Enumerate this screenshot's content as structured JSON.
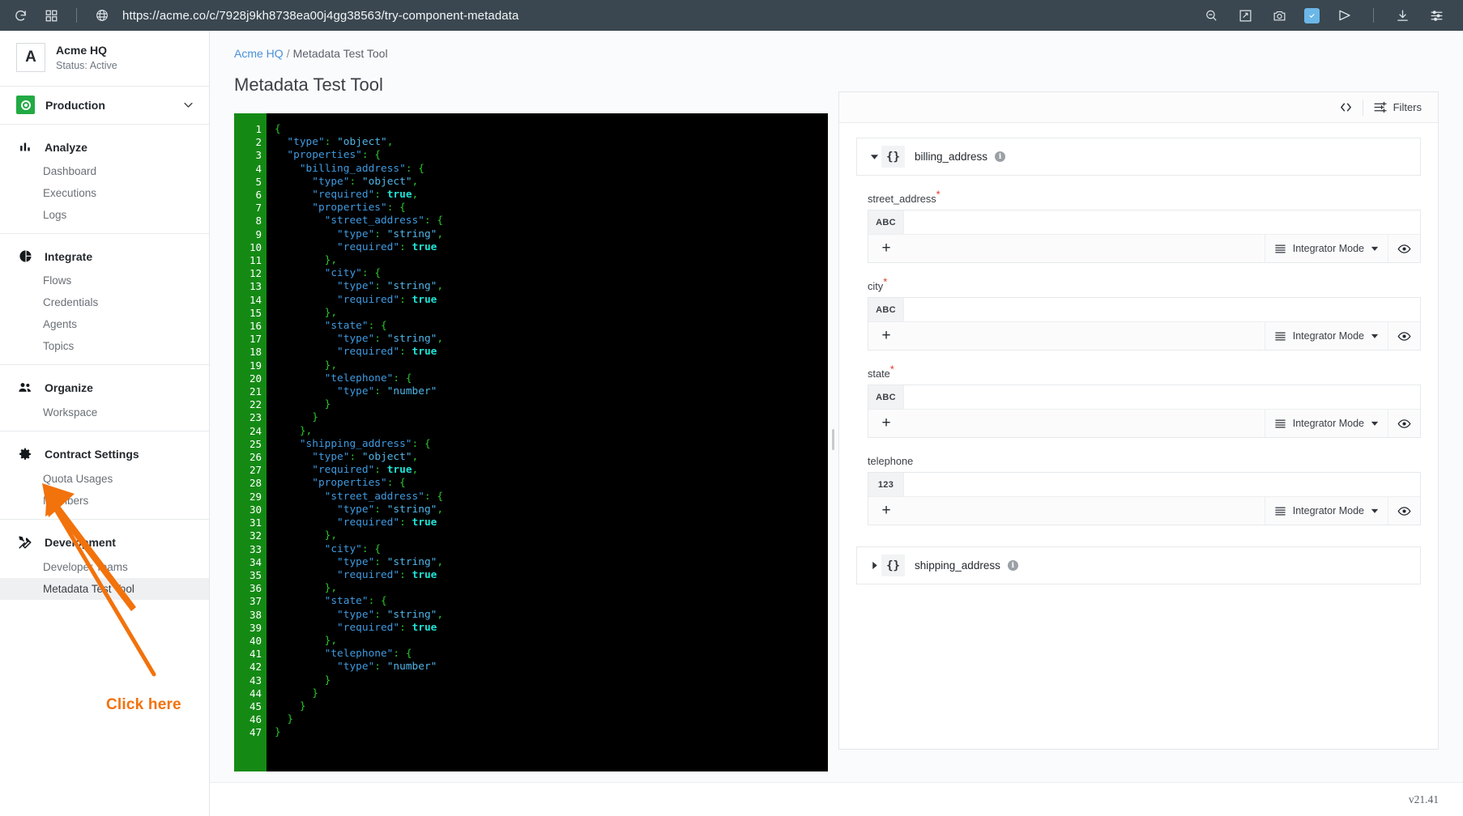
{
  "browser": {
    "url": "https://acme.co/c/7928j9kh8738ea00j4gg38563/try-component-metadata",
    "left_icons": [
      "reload-icon",
      "grid-icon",
      "globe-icon"
    ],
    "right_icons": [
      "zoom-out-icon",
      "pin-icon",
      "camera-icon",
      "shield-check-icon",
      "send-icon",
      "download-icon",
      "sliders-icon"
    ]
  },
  "sidebar": {
    "org": {
      "logo_letter": "A",
      "name": "Acme HQ",
      "status": "Status: Active"
    },
    "environment": {
      "label": "Production",
      "icon": "target-icon",
      "caret": "chevron-down-icon"
    },
    "groups": [
      {
        "icon": "bar-chart-icon",
        "label": "Analyze",
        "items": [
          {
            "label": "Dashboard",
            "active": false
          },
          {
            "label": "Executions",
            "active": false
          },
          {
            "label": "Logs",
            "active": false
          }
        ]
      },
      {
        "icon": "pie-chart-icon",
        "label": "Integrate",
        "items": [
          {
            "label": "Flows",
            "active": false
          },
          {
            "label": "Credentials",
            "active": false
          },
          {
            "label": "Agents",
            "active": false
          },
          {
            "label": "Topics",
            "active": false
          }
        ]
      },
      {
        "icon": "people-icon",
        "label": "Organize",
        "items": [
          {
            "label": "Workspace",
            "active": false
          }
        ]
      },
      {
        "icon": "gear-icon",
        "label": "Contract Settings",
        "items": [
          {
            "label": "Quota Usages",
            "active": false
          },
          {
            "label": "Members",
            "active": false
          }
        ]
      },
      {
        "icon": "tools-icon",
        "label": "Development",
        "items": [
          {
            "label": "Developer Teams",
            "active": false
          },
          {
            "label": "Metadata Test Tool",
            "active": true
          }
        ]
      }
    ],
    "annotation": {
      "label": "Click here",
      "color": "#f2720c"
    }
  },
  "content": {
    "breadcrumb": {
      "root": "Acme HQ",
      "separator": "/",
      "current": "Metadata Test Tool"
    },
    "page_title": "Metadata Test Tool"
  },
  "editor": {
    "language": "json",
    "total_lines": 47,
    "lines": [
      "{",
      "  \"type\": \"object\",",
      "  \"properties\": {",
      "    \"billing_address\": {",
      "      \"type\": \"object\",",
      "      \"required\": true,",
      "      \"properties\": {",
      "        \"street_address\": {",
      "          \"type\": \"string\",",
      "          \"required\": true",
      "        },",
      "        \"city\": {",
      "          \"type\": \"string\",",
      "          \"required\": true",
      "        },",
      "        \"state\": {",
      "          \"type\": \"string\",",
      "          \"required\": true",
      "        },",
      "        \"telephone\": {",
      "          \"type\": \"number\"",
      "        }",
      "      }",
      "    },",
      "    \"shipping_address\": {",
      "      \"type\": \"object\",",
      "      \"required\": true,",
      "      \"properties\": {",
      "        \"street_address\": {",
      "          \"type\": \"string\",",
      "          \"required\": true",
      "        },",
      "        \"city\": {",
      "          \"type\": \"string\",",
      "          \"required\": true",
      "        },",
      "        \"state\": {",
      "          \"type\": \"string\",",
      "          \"required\": true",
      "        },",
      "        \"telephone\": {",
      "          \"type\": \"number\"",
      "        }",
      "      }",
      "    }",
      "  }",
      "}"
    ]
  },
  "panel": {
    "toolbar": {
      "code_view_icon": "code-brackets-icon",
      "filters_label": "Filters",
      "filters_icon": "filters-icon"
    },
    "objects": [
      {
        "name": "billing_address",
        "expanded": true,
        "fields": [
          {
            "label": "street_address",
            "required": true,
            "type_badge": "ABC",
            "value": "",
            "add_label": "+",
            "mode_label": "Integrator Mode",
            "eye_icon": "eye-icon"
          },
          {
            "label": "city",
            "required": true,
            "type_badge": "ABC",
            "value": "",
            "add_label": "+",
            "mode_label": "Integrator Mode",
            "eye_icon": "eye-icon"
          },
          {
            "label": "state",
            "required": true,
            "type_badge": "ABC",
            "value": "",
            "add_label": "+",
            "mode_label": "Integrator Mode",
            "eye_icon": "eye-icon"
          },
          {
            "label": "telephone",
            "required": false,
            "type_badge": "123",
            "value": "",
            "add_label": "+",
            "mode_label": "Integrator Mode",
            "eye_icon": "eye-icon"
          }
        ]
      },
      {
        "name": "shipping_address",
        "expanded": false,
        "fields": []
      }
    ]
  },
  "footer": {
    "version": "v21.41"
  },
  "colors": {
    "browser_bar": "#3a4750",
    "accent_link": "#4a90d9",
    "annotation_orange": "#f2720c",
    "gutter_green": "#148a14",
    "env_green": "#22aa44",
    "required_red": "#e0392b"
  }
}
